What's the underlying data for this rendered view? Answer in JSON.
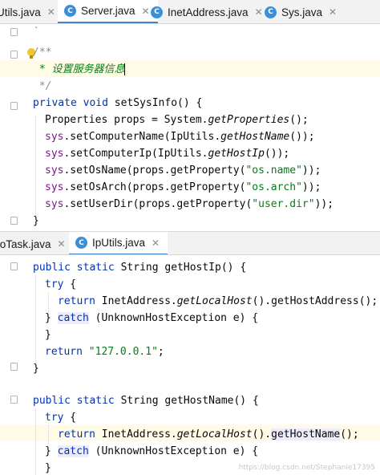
{
  "top_tabs": [
    {
      "label": "Utils.java",
      "active": false
    },
    {
      "label": "Server.java",
      "active": true
    },
    {
      "label": "InetAddress.java",
      "active": false
    },
    {
      "label": "Sys.java",
      "active": false
    }
  ],
  "top_code": {
    "doc_open": "/**",
    "doc_body": " * 设置服务器信息",
    "doc_close": " */",
    "decl_kw": "private",
    "decl_type": "void",
    "decl_name": "setSysInfo",
    "decl_tail": "() {",
    "l1_type": "Properties props = System.",
    "l1_call": "getProperties",
    "l1_tail": "();",
    "sys": "sys",
    "l2_a": ".setComputerName(IpUtils.",
    "l2_call": "getHostName",
    "l2_tail": "());",
    "l3_a": ".setComputerIp(IpUtils.",
    "l3_call": "getHostIp",
    "l3_tail": "());",
    "l4_a": ".setOsName(props.getProperty(",
    "l4_str": "\"os.name\"",
    "l4_tail": "));",
    "l5_a": ".setOsArch(props.getProperty(",
    "l5_str": "\"os.arch\"",
    "l5_tail": "));",
    "l6_a": ".setUserDir(props.getProperty(",
    "l6_str": "\"user.dir\"",
    "l6_tail": "));",
    "close": "}"
  },
  "bottom_tabs": [
    {
      "label": "toTask.java",
      "active": false
    },
    {
      "label": "IpUtils.java",
      "active": true
    }
  ],
  "bottom_code": {
    "public": "public",
    "static": "static",
    "string": "String",
    "m1_name": "getHostIp",
    "m_tail": "() {",
    "try": "try",
    "open_brace": " {",
    "ret": "return",
    "ret_body": "InetAddress.",
    "local": "getLocalHost",
    "addr_tail": "().getHostAddress();",
    "brace_close": "}",
    "catch": "catch",
    "catch_tail": " (UnknownHostException e) {",
    "ret_str": "\"127.0.0.1\"",
    "semi": ";",
    "m2_name": "getHostName",
    "name_mid": "().",
    "name_call": "getHostName",
    "name_tail": "();"
  },
  "watermark": "https://blog.csdn.net/Stephanie17395"
}
